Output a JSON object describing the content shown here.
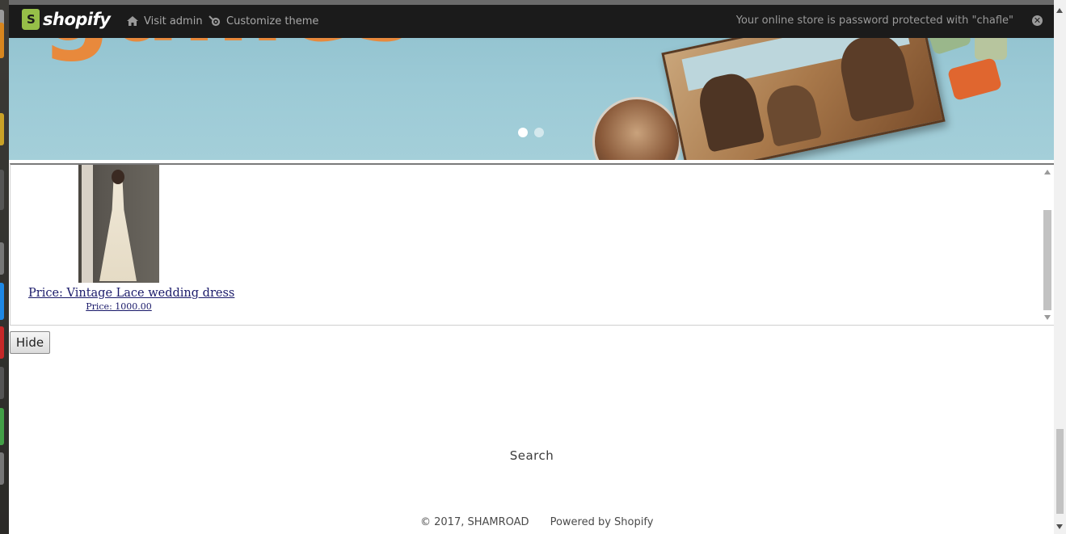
{
  "admin_bar": {
    "logo_text": "shopify",
    "visit_admin": "Visit admin",
    "customize_theme": "Customize theme",
    "notice": "Your online store is password protected with \"chafle\"",
    "close_glyph": "✕"
  },
  "hero": {
    "title_fragment": "games",
    "slides": 2,
    "active_slide": 1
  },
  "product": {
    "name": "Price: Vintage Lace wedding dress",
    "price": "Price: 1000.00"
  },
  "buttons": {
    "hide": "Hide"
  },
  "search": {
    "label": "Search"
  },
  "footer": {
    "copyright": "© 2017, SHAMROAD",
    "powered": "Powered by Shopify"
  },
  "colors": {
    "admin_bar_bg": "#1b1b1b",
    "shopify_green": "#96bf48",
    "link_color": "#1a1a6a"
  }
}
